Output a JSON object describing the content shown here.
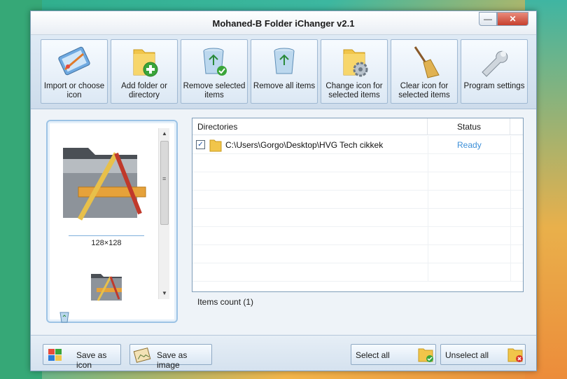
{
  "window": {
    "title": "Mohaned-B Folder iChanger v2.1",
    "minimize_glyph": "—",
    "close_glyph": "✕"
  },
  "toolbar": [
    {
      "key": "import",
      "label": "Import or choose icon",
      "icon": "paint-palette-icon"
    },
    {
      "key": "add",
      "label": "Add folder or directory",
      "icon": "folder-add-icon"
    },
    {
      "key": "remove-selected",
      "label": "Remove selected items",
      "icon": "recycle-bin-check-icon"
    },
    {
      "key": "remove-all",
      "label": "Remove all items",
      "icon": "recycle-bin-icon"
    },
    {
      "key": "change-icon",
      "label": "Change icon for selected items",
      "icon": "folder-gear-icon"
    },
    {
      "key": "clear-icon",
      "label": "Clear icon for selected items",
      "icon": "broom-icon"
    },
    {
      "key": "settings",
      "label": "Program settings",
      "icon": "wrench-icon"
    }
  ],
  "preview": {
    "size_label": "128×128"
  },
  "listview": {
    "headers": {
      "directories": "Directories",
      "status": "Status"
    },
    "rows": [
      {
        "checked": true,
        "check_glyph": "✓",
        "path": "C:\\Users\\Gorgo\\Desktop\\HVG Tech cikkek",
        "status": "Ready"
      }
    ],
    "items_count": "Items count (1)"
  },
  "bottom": {
    "save_icon": "Save as icon",
    "save_image": "Save as image",
    "select_all": "Select all",
    "unselect_all": "Unselect all"
  },
  "colors": {
    "status_ready": "#3c8fd8",
    "accent_border": "#9cc3e5"
  }
}
